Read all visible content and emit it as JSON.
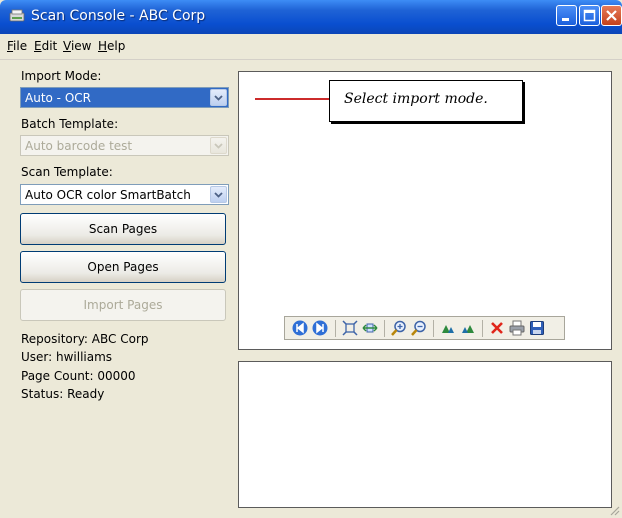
{
  "window": {
    "title": "Scan Console - ABC Corp",
    "title_icon": "scanner-icon",
    "controls": [
      "minimize-icon",
      "maximize-icon",
      "close-icon"
    ]
  },
  "menu": {
    "items": [
      {
        "label": "File",
        "mnemonic": "F",
        "rest": "ile"
      },
      {
        "label": "Edit",
        "mnemonic": "E",
        "rest": "dit"
      },
      {
        "label": "View",
        "mnemonic": "V",
        "rest": "iew"
      },
      {
        "label": "Help",
        "mnemonic": "H",
        "rest": "elp"
      }
    ]
  },
  "left": {
    "import_mode_label": "Import Mode:",
    "import_mode_value": "Auto - OCR",
    "batch_template_label": "Batch Template:",
    "batch_template_value": "Auto barcode test",
    "scan_template_label": "Scan Template:",
    "scan_template_value": "Auto OCR color SmartBatch",
    "scan_button": "Scan Pages",
    "open_button": "Open Pages",
    "import_button": "Import Pages",
    "repository": "Repository: ABC Corp",
    "user": "User: hwilliams",
    "page_count": "Page Count: 00000",
    "status": "Status: Ready"
  },
  "preview": {
    "callout_text": "Select import mode."
  },
  "toolbar": {
    "icons": [
      "first-page-icon",
      "last-page-icon",
      "fit-page-icon",
      "fit-width-icon",
      "zoom-in-icon",
      "zoom-out-icon",
      "rotate-left-icon",
      "rotate-right-icon",
      "delete-icon",
      "print-icon",
      "save-icon"
    ]
  },
  "colors": {
    "titlebar": "#0a4fd0",
    "selection": "#316ac5",
    "callout_line": "#cc2b2b",
    "window_bg": "#ece9d8"
  }
}
